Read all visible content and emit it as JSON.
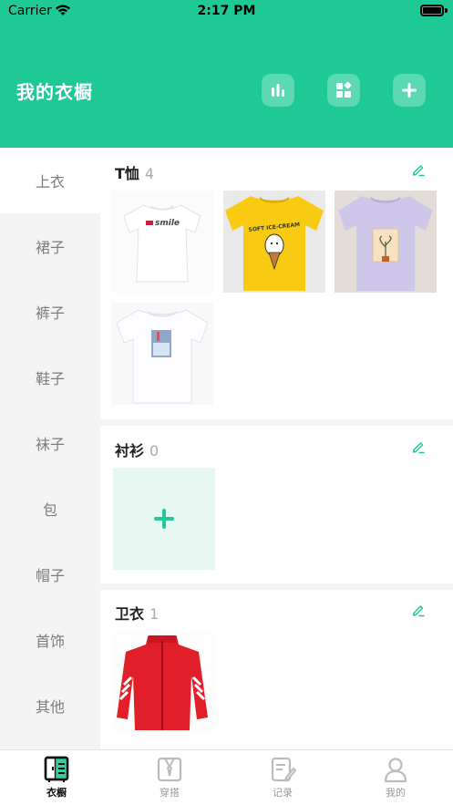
{
  "status_bar": {
    "carrier": "Carrier",
    "time": "2:17 PM"
  },
  "header": {
    "title": "我的衣橱",
    "accent_color": "#1ec995",
    "buttons": [
      "stats-icon",
      "grid-icon",
      "plus-icon"
    ]
  },
  "sidebar": {
    "items": [
      {
        "label": "上衣",
        "active": true
      },
      {
        "label": "裙子"
      },
      {
        "label": "裤子"
      },
      {
        "label": "鞋子"
      },
      {
        "label": "袜子"
      },
      {
        "label": "包"
      },
      {
        "label": "帽子"
      },
      {
        "label": "首饰"
      },
      {
        "label": "其他"
      }
    ]
  },
  "sections": [
    {
      "title": "T恤",
      "count": "4",
      "items": [
        "smile-white-tshirt",
        "yellow-ice-cream-tshirt",
        "lavender-graphic-tshirt",
        "white-print-tshirt"
      ]
    },
    {
      "title": "衬衫",
      "count": "0",
      "items": []
    },
    {
      "title": "卫衣",
      "count": "1",
      "items": [
        "red-track-jacket"
      ]
    }
  ],
  "tabbar": {
    "items": [
      {
        "label": "衣橱",
        "icon": "wardrobe-icon",
        "active": true
      },
      {
        "label": "穿搭",
        "icon": "outfit-icon"
      },
      {
        "label": "记录",
        "icon": "record-icon"
      },
      {
        "label": "我的",
        "icon": "profile-icon"
      }
    ]
  },
  "thumb_labels": {
    "smile": "smile",
    "icecream": "SOFT ICE-CREAM"
  }
}
